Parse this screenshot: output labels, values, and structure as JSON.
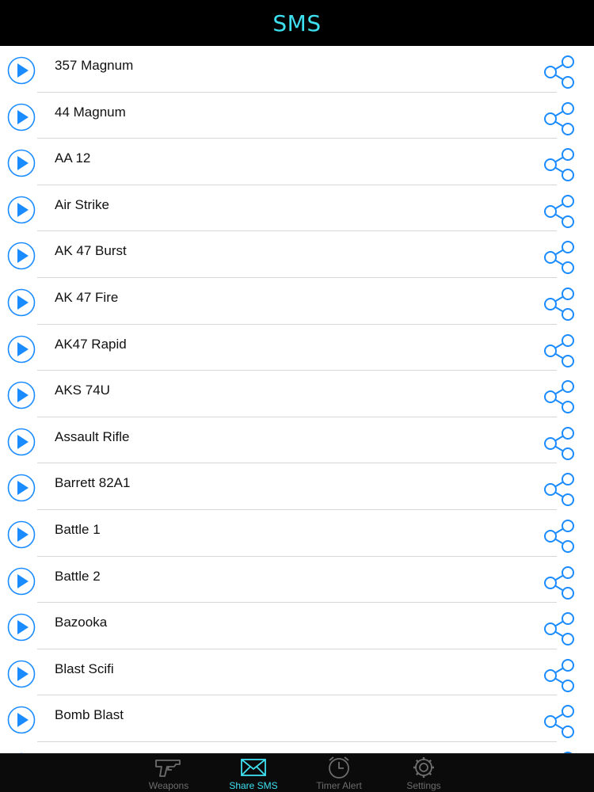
{
  "header": {
    "title": "SMS"
  },
  "list": {
    "items": [
      {
        "label": "357 Magnum"
      },
      {
        "label": "44 Magnum"
      },
      {
        "label": "AA 12"
      },
      {
        "label": "Air Strike"
      },
      {
        "label": "AK 47 Burst"
      },
      {
        "label": "AK 47 Fire"
      },
      {
        "label": "AK47 Rapid"
      },
      {
        "label": "AKS 74U"
      },
      {
        "label": "Assault Rifle"
      },
      {
        "label": "Barrett 82A1"
      },
      {
        "label": "Battle 1"
      },
      {
        "label": "Battle 2"
      },
      {
        "label": "Bazooka"
      },
      {
        "label": "Blast Scifi"
      },
      {
        "label": "Bomb Blast"
      }
    ]
  },
  "tabbar": {
    "tabs": [
      {
        "label": "Weapons",
        "icon": "pistol-icon"
      },
      {
        "label": "Share SMS",
        "icon": "envelope-icon"
      },
      {
        "label": "Timer Alert",
        "icon": "alarm-clock-icon"
      },
      {
        "label": "Settings",
        "icon": "gear-icon"
      }
    ],
    "active": "Share SMS"
  },
  "colors": {
    "header_bg": "#000000",
    "title": "#3ee0f0",
    "icon_blue": "#1a8cff",
    "tabbar_bg": "#0b0b0b",
    "tab_active": "#3ee0f0",
    "tab_inactive": "#6d6d6d"
  }
}
